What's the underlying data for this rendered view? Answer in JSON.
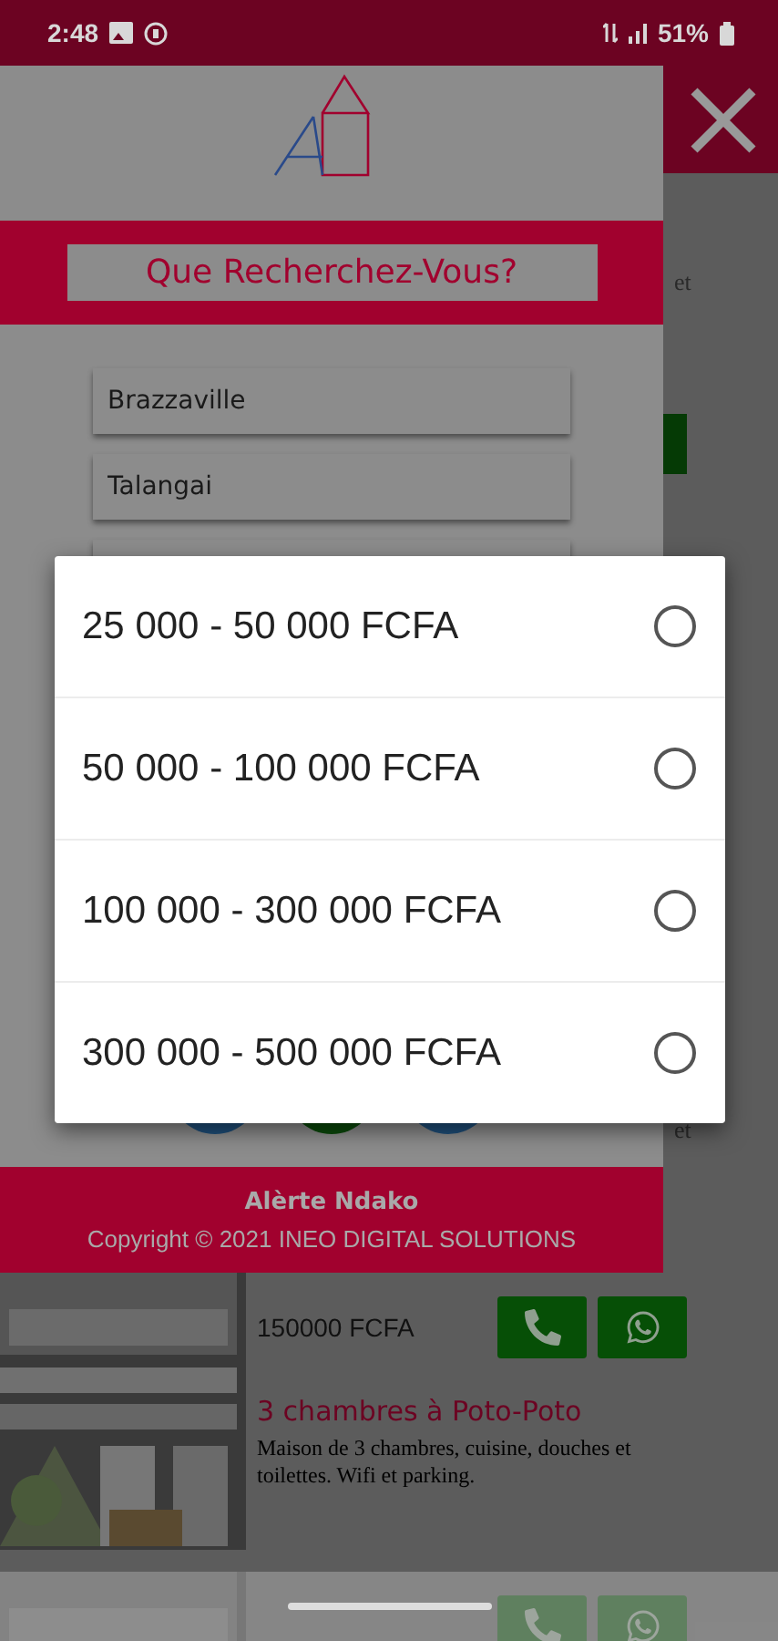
{
  "status_bar": {
    "time": "2:48",
    "battery": "51%"
  },
  "background_page": {
    "fragments": [
      "et",
      "et"
    ]
  },
  "listings": [
    {
      "price": "150000 FCFA",
      "title": "3 chambres à Poto-Poto",
      "description": "Maison de 3 chambres, cuisine, douches et toilettes. Wifi et parking.",
      "kind": "picture"
    },
    {
      "kind": "picture"
    }
  ],
  "drawer": {
    "heading": "Que Recherchez-Vous?",
    "fields": [
      {
        "value": "Brazzaville"
      },
      {
        "value": "Talangai"
      }
    ],
    "footer": {
      "brand": "Alèrte Ndako",
      "copyright": "Copyright © 2021 INEO DIGITAL SOLUTIONS"
    }
  },
  "dialog": {
    "options": [
      {
        "label": "25 000 - 50 000 FCFA",
        "selected": false
      },
      {
        "label": "50 000 - 100 000 FCFA",
        "selected": false
      },
      {
        "label": "100 000 - 300 000 FCFA",
        "selected": false
      },
      {
        "label": "300 000 - 500 000 FCFA",
        "selected": false
      }
    ]
  }
}
